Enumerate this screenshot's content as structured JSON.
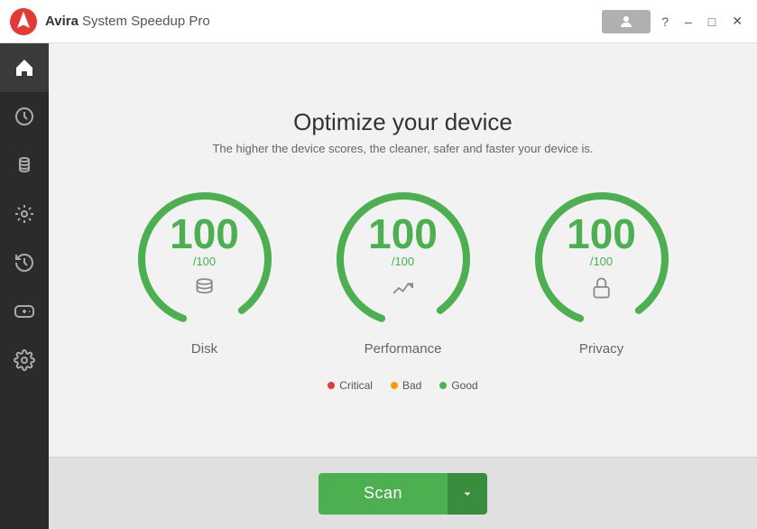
{
  "titlebar": {
    "logo_alt": "Avira logo",
    "app_name": "Avira",
    "app_subtitle": "System Speedup Pro",
    "user_button_label": "",
    "help_label": "?",
    "minimize_label": "–",
    "maximize_label": "□",
    "close_label": "✕"
  },
  "sidebar": {
    "items": [
      {
        "id": "home",
        "label": "Home",
        "icon": "home-icon",
        "active": true
      },
      {
        "id": "clock",
        "label": "Scheduler",
        "icon": "clock-icon",
        "active": false
      },
      {
        "id": "cleaner",
        "label": "Cleaner",
        "icon": "cleaner-icon",
        "active": false
      },
      {
        "id": "optimizer",
        "label": "Optimizer",
        "icon": "optimizer-icon",
        "active": false
      },
      {
        "id": "history",
        "label": "History",
        "icon": "history-icon",
        "active": false
      },
      {
        "id": "gaming",
        "label": "Gaming",
        "icon": "gaming-icon",
        "active": false
      },
      {
        "id": "settings",
        "label": "Settings",
        "icon": "settings-icon",
        "active": false
      }
    ]
  },
  "main": {
    "title": "Optimize your device",
    "subtitle": "The higher the device scores, the cleaner, safer and faster your device is.",
    "gauges": [
      {
        "id": "disk",
        "label": "Disk",
        "score": "100",
        "max": "/100",
        "icon": "disk-icon"
      },
      {
        "id": "performance",
        "label": "Performance",
        "score": "100",
        "max": "/100",
        "icon": "performance-icon"
      },
      {
        "id": "privacy",
        "label": "Privacy",
        "score": "100",
        "max": "/100",
        "icon": "privacy-icon"
      }
    ],
    "legend": [
      {
        "id": "critical",
        "label": "Critical",
        "color": "#e53935"
      },
      {
        "id": "bad",
        "label": "Bad",
        "color": "#ff9800"
      },
      {
        "id": "good",
        "label": "Good",
        "color": "#4caf50"
      }
    ],
    "scan_button_label": "Scan",
    "accent_color": "#4caf50"
  }
}
